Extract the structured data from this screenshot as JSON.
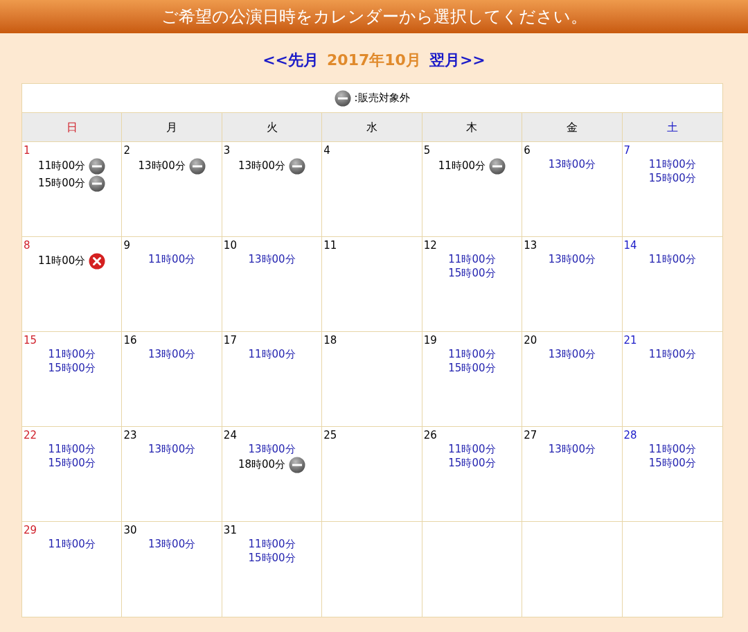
{
  "banner": {
    "title": "ご希望の公演日時をカレンダーから選択してください。"
  },
  "month_nav": {
    "prev": "<<先月",
    "current": "2017年10月",
    "next": "翌月>>"
  },
  "legend": {
    "label": ":販売対象外"
  },
  "weekdays": [
    {
      "label": "日",
      "kind": "sunday"
    },
    {
      "label": "月",
      "kind": "weekday"
    },
    {
      "label": "火",
      "kind": "weekday"
    },
    {
      "label": "水",
      "kind": "weekday"
    },
    {
      "label": "木",
      "kind": "weekday"
    },
    {
      "label": "金",
      "kind": "weekday"
    },
    {
      "label": "土",
      "kind": "saturday"
    }
  ],
  "weeks": [
    [
      {
        "kind": "day",
        "day": "1",
        "shows": [
          {
            "time": "11時00分",
            "kind": "closed"
          },
          {
            "time": "15時00分",
            "kind": "closed"
          }
        ]
      },
      {
        "kind": "day",
        "day": "2",
        "shows": [
          {
            "time": "13時00分",
            "kind": "closed"
          }
        ]
      },
      {
        "kind": "day",
        "day": "3",
        "shows": [
          {
            "time": "13時00分",
            "kind": "closed"
          }
        ]
      },
      {
        "kind": "day",
        "day": "4"
      },
      {
        "kind": "day",
        "day": "5",
        "shows": [
          {
            "time": "11時00分",
            "kind": "closed"
          }
        ]
      },
      {
        "kind": "day",
        "day": "6",
        "shows": [
          {
            "time": "13時00分",
            "kind": "open"
          }
        ]
      },
      {
        "kind": "day",
        "day": "7",
        "shows": [
          {
            "time": "11時00分",
            "kind": "open"
          },
          {
            "time": "15時00分",
            "kind": "open"
          }
        ]
      }
    ],
    [
      {
        "kind": "day",
        "day": "8",
        "shows": [
          {
            "time": "11時00分",
            "kind": "soldout"
          }
        ]
      },
      {
        "kind": "day",
        "day": "9",
        "shows": [
          {
            "time": "11時00分",
            "kind": "open"
          }
        ]
      },
      {
        "kind": "day",
        "day": "10",
        "shows": [
          {
            "time": "13時00分",
            "kind": "open"
          }
        ]
      },
      {
        "kind": "day",
        "day": "11"
      },
      {
        "kind": "day",
        "day": "12",
        "shows": [
          {
            "time": "11時00分",
            "kind": "open"
          },
          {
            "time": "15時00分",
            "kind": "open"
          }
        ]
      },
      {
        "kind": "day",
        "day": "13",
        "shows": [
          {
            "time": "13時00分",
            "kind": "open"
          }
        ]
      },
      {
        "kind": "day",
        "day": "14",
        "shows": [
          {
            "time": "11時00分",
            "kind": "open"
          }
        ]
      }
    ],
    [
      {
        "kind": "day",
        "day": "15",
        "shows": [
          {
            "time": "11時00分",
            "kind": "open"
          },
          {
            "time": "15時00分",
            "kind": "open"
          }
        ]
      },
      {
        "kind": "day",
        "day": "16",
        "shows": [
          {
            "time": "13時00分",
            "kind": "open"
          }
        ]
      },
      {
        "kind": "day",
        "day": "17",
        "shows": [
          {
            "time": "11時00分",
            "kind": "open"
          }
        ]
      },
      {
        "kind": "day",
        "day": "18"
      },
      {
        "kind": "day",
        "day": "19",
        "shows": [
          {
            "time": "11時00分",
            "kind": "open"
          },
          {
            "time": "15時00分",
            "kind": "open"
          }
        ]
      },
      {
        "kind": "day",
        "day": "20",
        "shows": [
          {
            "time": "13時00分",
            "kind": "open"
          }
        ]
      },
      {
        "kind": "day",
        "day": "21",
        "shows": [
          {
            "time": "11時00分",
            "kind": "open"
          }
        ]
      }
    ],
    [
      {
        "kind": "day",
        "day": "22",
        "shows": [
          {
            "time": "11時00分",
            "kind": "open"
          },
          {
            "time": "15時00分",
            "kind": "open"
          }
        ]
      },
      {
        "kind": "day",
        "day": "23",
        "shows": [
          {
            "time": "13時00分",
            "kind": "open"
          }
        ]
      },
      {
        "kind": "day",
        "day": "24",
        "shows": [
          {
            "time": "13時00分",
            "kind": "open"
          },
          {
            "time": "18時00分",
            "kind": "closed"
          }
        ]
      },
      {
        "kind": "day",
        "day": "25"
      },
      {
        "kind": "day",
        "day": "26",
        "shows": [
          {
            "time": "11時00分",
            "kind": "open"
          },
          {
            "time": "15時00分",
            "kind": "open"
          }
        ]
      },
      {
        "kind": "day",
        "day": "27",
        "shows": [
          {
            "time": "13時00分",
            "kind": "open"
          }
        ]
      },
      {
        "kind": "day",
        "day": "28",
        "shows": [
          {
            "time": "11時00分",
            "kind": "open"
          },
          {
            "time": "15時00分",
            "kind": "open"
          }
        ]
      }
    ],
    [
      {
        "kind": "day",
        "day": "29",
        "shows": [
          {
            "time": "11時00分",
            "kind": "open"
          }
        ]
      },
      {
        "kind": "day",
        "day": "30",
        "shows": [
          {
            "time": "13時00分",
            "kind": "open"
          }
        ]
      },
      {
        "kind": "day",
        "day": "31",
        "shows": [
          {
            "time": "11時00分",
            "kind": "open"
          },
          {
            "time": "15時00分",
            "kind": "open"
          }
        ]
      },
      {
        "kind": "empty"
      },
      {
        "kind": "empty"
      },
      {
        "kind": "empty"
      },
      {
        "kind": "empty"
      }
    ]
  ]
}
